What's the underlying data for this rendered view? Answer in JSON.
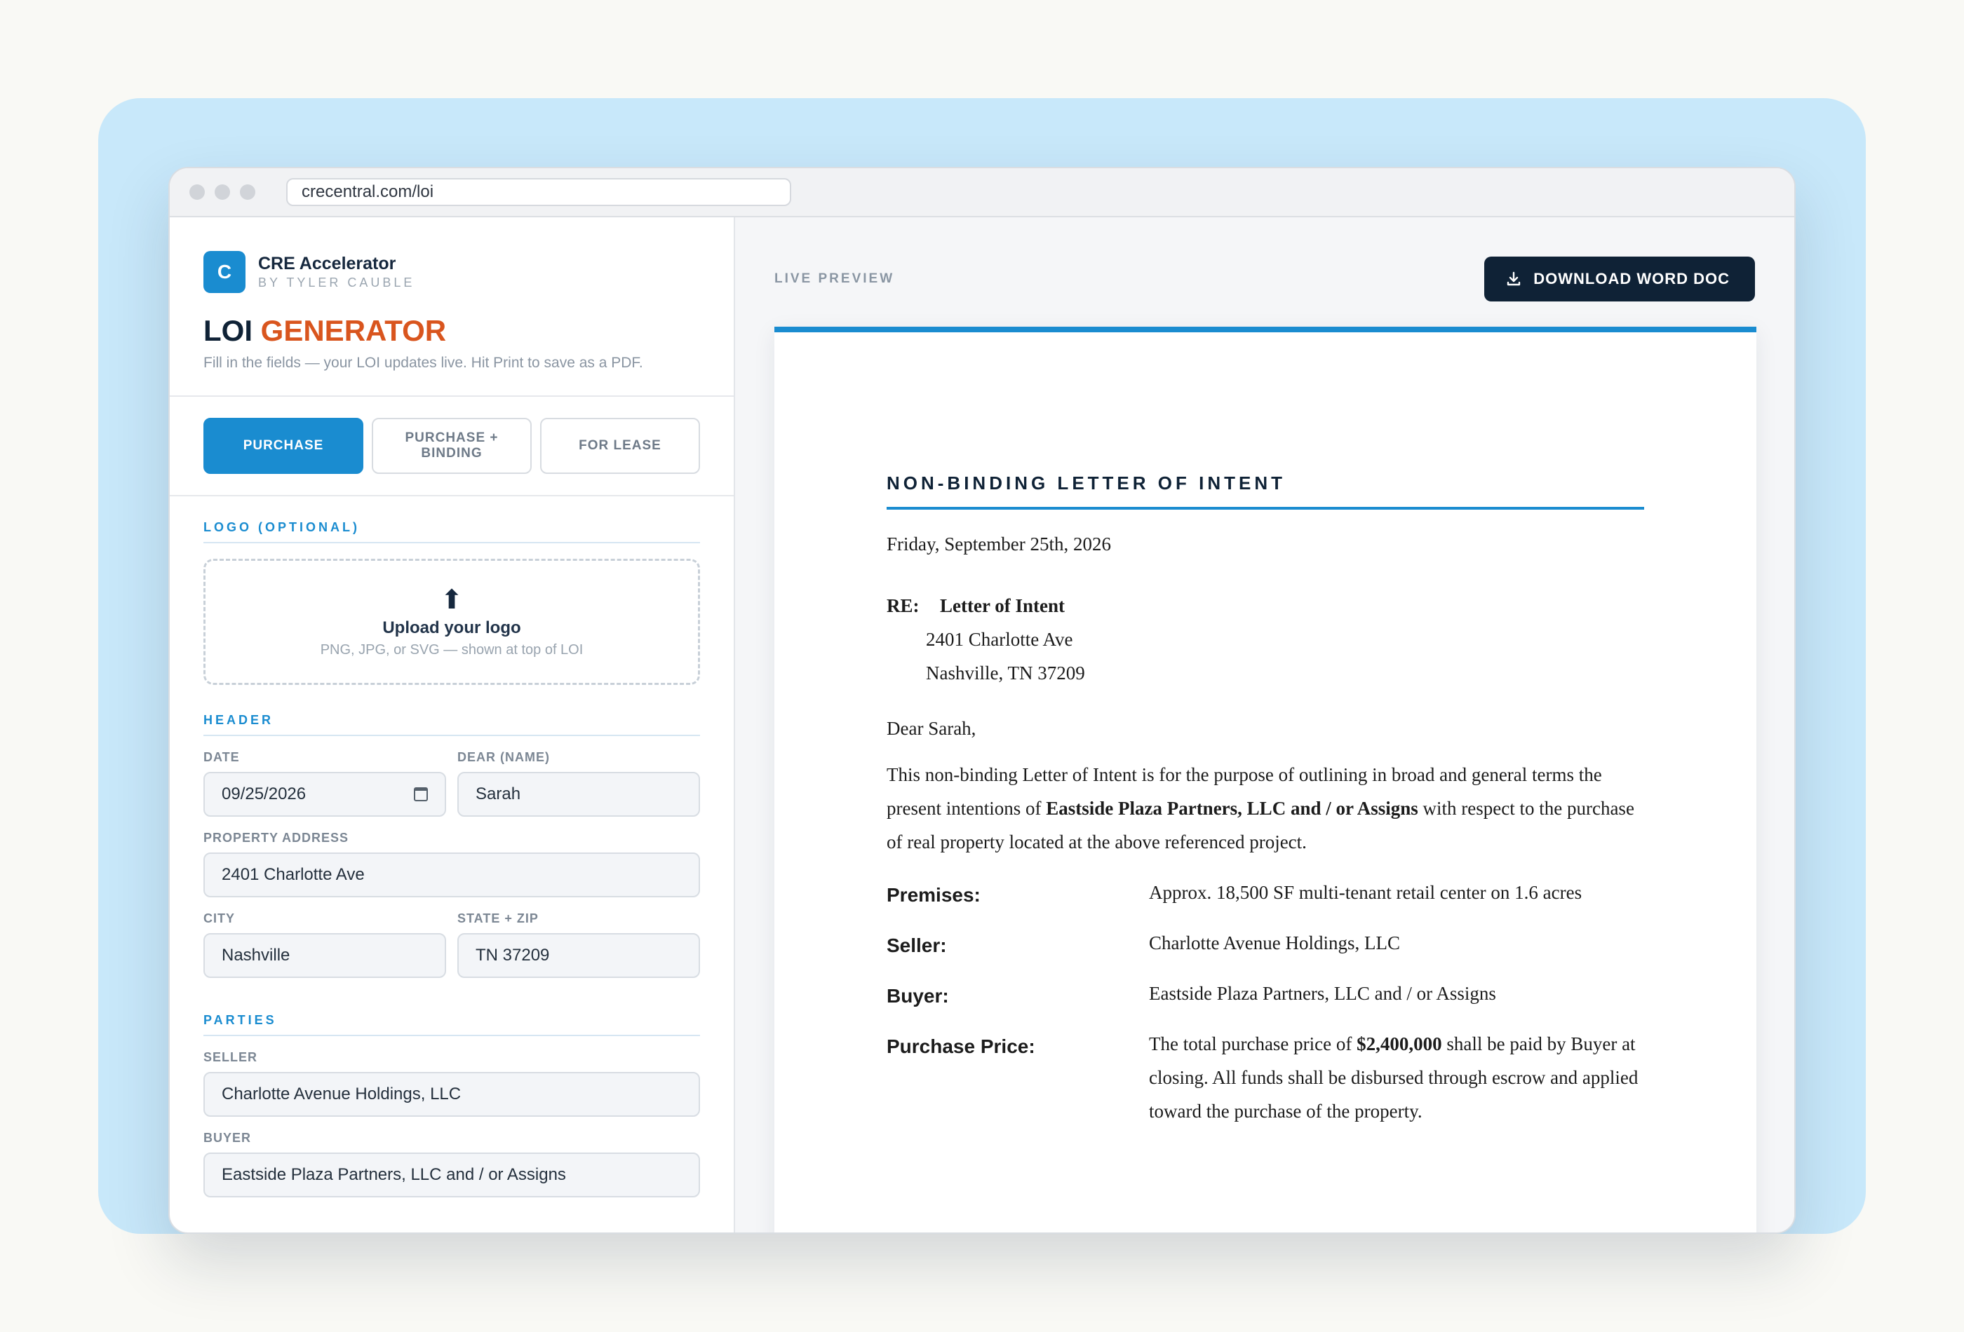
{
  "browser": {
    "url": "crecentral.com/loi"
  },
  "brand": {
    "logo_letter": "C",
    "name": "CRE Accelerator",
    "byline": "BY TYLER CAUBLE"
  },
  "page": {
    "title_part1": "LOI",
    "title_part2": "GENERATOR",
    "subtitle": "Fill in the fields — your LOI updates live. Hit Print to save as a PDF."
  },
  "tabs": [
    {
      "label": "PURCHASE",
      "active": true
    },
    {
      "label": "PURCHASE + BINDING",
      "active": false
    },
    {
      "label": "FOR LEASE",
      "active": false
    }
  ],
  "logo_section": {
    "label": "LOGO (OPTIONAL)",
    "upload_icon": "upload-arrow-icon",
    "upload_title": "Upload your logo",
    "upload_hint": "PNG, JPG, or SVG — shown at top of LOI"
  },
  "header_section": {
    "label": "HEADER",
    "date_label": "DATE",
    "date_value": "09/25/2026",
    "dear_label": "DEAR (NAME)",
    "dear_value": "Sarah",
    "address_label": "PROPERTY ADDRESS",
    "address_value": "2401 Charlotte Ave",
    "city_label": "CITY",
    "city_value": "Nashville",
    "statezip_label": "STATE + ZIP",
    "statezip_value": "TN 37209"
  },
  "parties_section": {
    "label": "PARTIES",
    "seller_label": "SELLER",
    "seller_value": "Charlotte Avenue Holdings, LLC",
    "buyer_label": "BUYER",
    "buyer_value": "Eastside Plaza Partners, LLC and / or Assigns"
  },
  "preview": {
    "label": "LIVE PREVIEW",
    "download_label": "DOWNLOAD WORD DOC"
  },
  "document": {
    "title": "NON-BINDING LETTER OF INTENT",
    "date": "Friday, September 25th, 2026",
    "re_label": "RE:",
    "re_title": "Letter of Intent",
    "re_address": "2401 Charlotte Ave",
    "re_city": "Nashville, TN 37209",
    "salutation": "Dear Sarah,",
    "intro_before": "This non-binding Letter of Intent is for the purpose of outlining in broad and general terms the present intentions of ",
    "intro_buyer": "Eastside Plaza Partners, LLC and / or Assigns",
    "intro_after": " with respect to the purchase of real property located at the above referenced project.",
    "premises_label": "Premises:",
    "premises_value": "Approx. 18,500 SF multi-tenant retail center on 1.6 acres",
    "seller_label": "Seller:",
    "seller_value": "Charlotte Avenue Holdings, LLC",
    "buyer_label": "Buyer:",
    "buyer_value": "Eastside Plaza Partners, LLC and / or Assigns",
    "price_label": "Purchase Price:",
    "price_before": "The total purchase price of ",
    "price_amount": "$2,400,000",
    "price_after": " shall be paid by Buyer at closing. All funds shall be disbursed through escrow and applied toward the purchase of the property."
  }
}
